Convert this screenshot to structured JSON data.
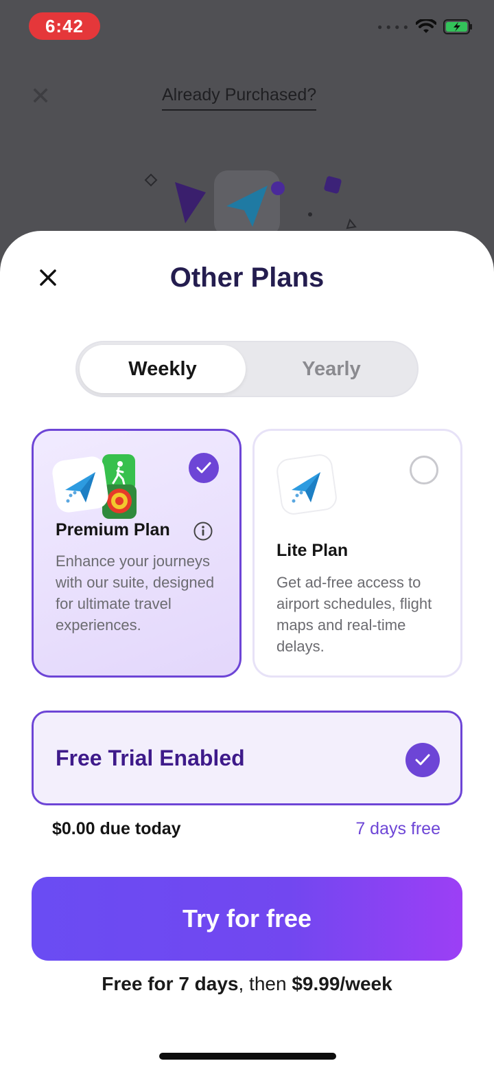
{
  "status_bar": {
    "time": "6:42"
  },
  "background": {
    "already_purchased": "Already Purchased?"
  },
  "sheet": {
    "title": "Other Plans",
    "tabs": [
      {
        "label": "Weekly",
        "selected": true
      },
      {
        "label": "Yearly",
        "selected": false
      }
    ],
    "plans": [
      {
        "name": "Premium Plan",
        "description": "Enhance your journeys with our suite, designed for ultimate travel experiences.",
        "selected": true
      },
      {
        "name": "Lite Plan",
        "description": "Get ad-free access to airport schedules, flight maps and real-time delays.",
        "selected": false
      }
    ],
    "free_trial": {
      "label": "Free Trial Enabled",
      "enabled": true
    },
    "due_today": "$0.00 due today",
    "days_free": "7 days free",
    "cta_label": "Try for free",
    "footer": {
      "part1": "Free for 7 days",
      "part2": ", then ",
      "part3": "$9.99/week"
    }
  },
  "colors": {
    "accent": "#6d45d6",
    "cta_start": "#6a4cf3",
    "cta_end": "#9c3ff5",
    "title": "#241d4f"
  }
}
